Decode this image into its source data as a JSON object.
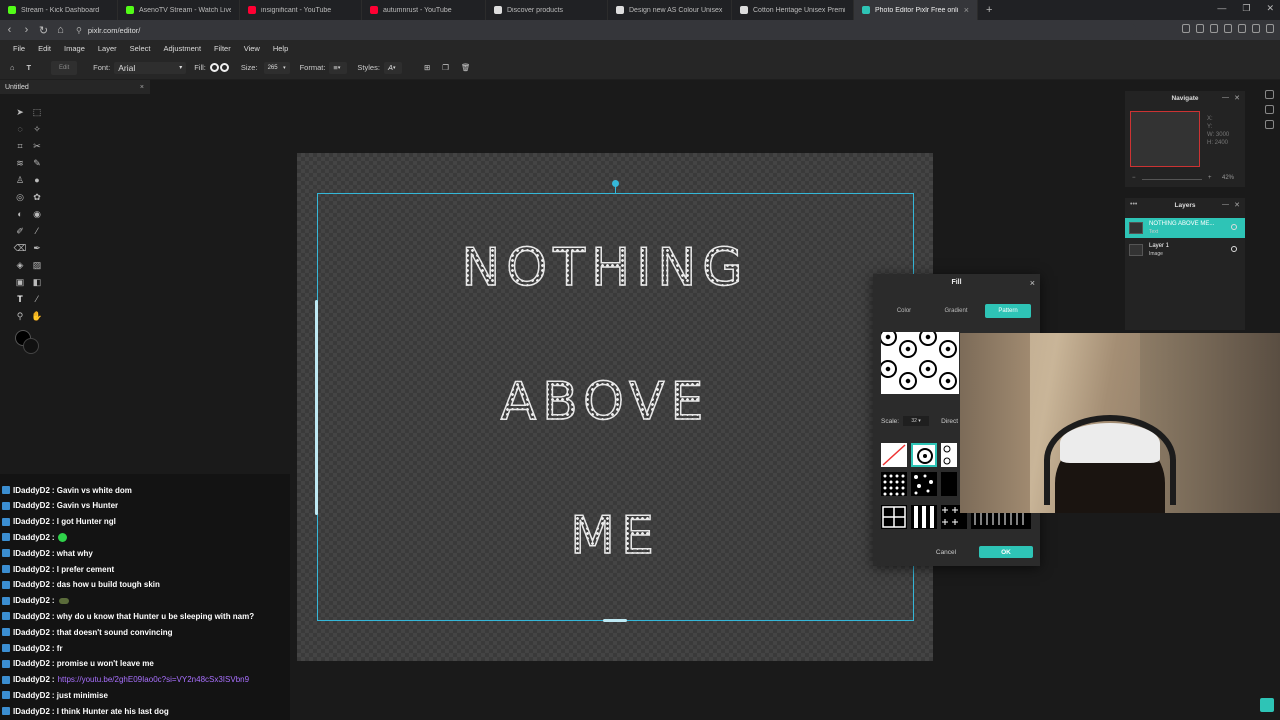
{
  "browser": {
    "tabs": [
      {
        "label": "Stream - Kick Dashboard",
        "color": "#53fc18"
      },
      {
        "label": "AsenoTV Stream - Watch Live on Kick",
        "color": "#53fc18"
      },
      {
        "label": "insignificant - YouTube",
        "color": "#ff0033"
      },
      {
        "label": "autumnrust - YouTube",
        "color": "#ff0033"
      },
      {
        "label": "Discover products",
        "color": "#dddddd"
      },
      {
        "label": "Design new AS Colour Unisex Premi...",
        "color": "#dddddd"
      },
      {
        "label": "Cotton Heritage Unisex Premium He...",
        "color": "#dddddd"
      },
      {
        "label": "Photo Editor Pixlr Free online Ima...",
        "color": "#2ec4b6"
      }
    ],
    "new_tab": "+",
    "url": "pixlr.com/editor/"
  },
  "menu": [
    "File",
    "Edit",
    "Image",
    "Layer",
    "Select",
    "Adjustment",
    "Filter",
    "View",
    "Help"
  ],
  "toolbar": {
    "edit_label": "Edit",
    "font_label": "Font:",
    "font_value": "Arial",
    "fill_label": "Fill:",
    "size_label": "Size:",
    "size_value": "265",
    "format_label": "Format:",
    "styles_label": "Styles:"
  },
  "document": {
    "tab_title": "Untitled",
    "close": "×"
  },
  "canvas_text": {
    "line1": "NOTHING",
    "line2": "ABOVE",
    "line3": "ME"
  },
  "chat": [
    {
      "user": "IDaddyD2",
      "text": ": Gavin vs white dom"
    },
    {
      "user": "IDaddyD2",
      "text": ": Gavin vs Hunter"
    },
    {
      "user": "IDaddyD2",
      "text": ": I got Hunter ngl"
    },
    {
      "user": "IDaddyD2",
      "text": ":",
      "emote": "green"
    },
    {
      "user": "IDaddyD2",
      "text": ": what why"
    },
    {
      "user": "IDaddyD2",
      "text": ": I prefer cement"
    },
    {
      "user": "IDaddyD2",
      "text": ": das how u build tough skin"
    },
    {
      "user": "IDaddyD2",
      "text": ":",
      "emote": "frog"
    },
    {
      "user": "IDaddyD2",
      "text": ": why do u know that Hunter u be sleeping with nam?"
    },
    {
      "user": "IDaddyD2",
      "text": ": that doesn't sound convincing"
    },
    {
      "user": "IDaddyD2",
      "text": ": fr"
    },
    {
      "user": "IDaddyD2",
      "text": ": promise u won't leave me"
    },
    {
      "user": "IDaddyD2",
      "text": ":",
      "link": "https://youtu.be/2ghE09Iao0c?si=VY2n48cSx3ISVbn9"
    },
    {
      "user": "IDaddyD2",
      "text": ": just minimise"
    },
    {
      "user": "IDaddyD2",
      "text": ": I think Hunter ate his last dog"
    }
  ],
  "navigate": {
    "title": "Navigate",
    "x_label": "X:",
    "y_label": "Y:",
    "w_label": "W:",
    "w_value": "3000",
    "h_label": "H:",
    "h_value": "2400",
    "zoom": "42%",
    "minus": "−",
    "plus": "+"
  },
  "layers": {
    "title": "Layers",
    "items": [
      {
        "name": "NOTHING ABOVE ME...",
        "type": "Text",
        "selected": true
      },
      {
        "name": "Layer 1",
        "type": "Image",
        "selected": false
      }
    ]
  },
  "fill_dialog": {
    "title": "Fill",
    "close": "×",
    "tabs": [
      "Color",
      "Gradient",
      "Pattern"
    ],
    "active_tab": "Pattern",
    "scale_label": "Scale:",
    "scale_value": "32",
    "direction_label": "Direct",
    "cancel": "Cancel",
    "ok": "OK"
  },
  "colors": {
    "accent": "#2ec4b6",
    "selection": "#35b7d8",
    "chat_link": "#a970ff"
  }
}
